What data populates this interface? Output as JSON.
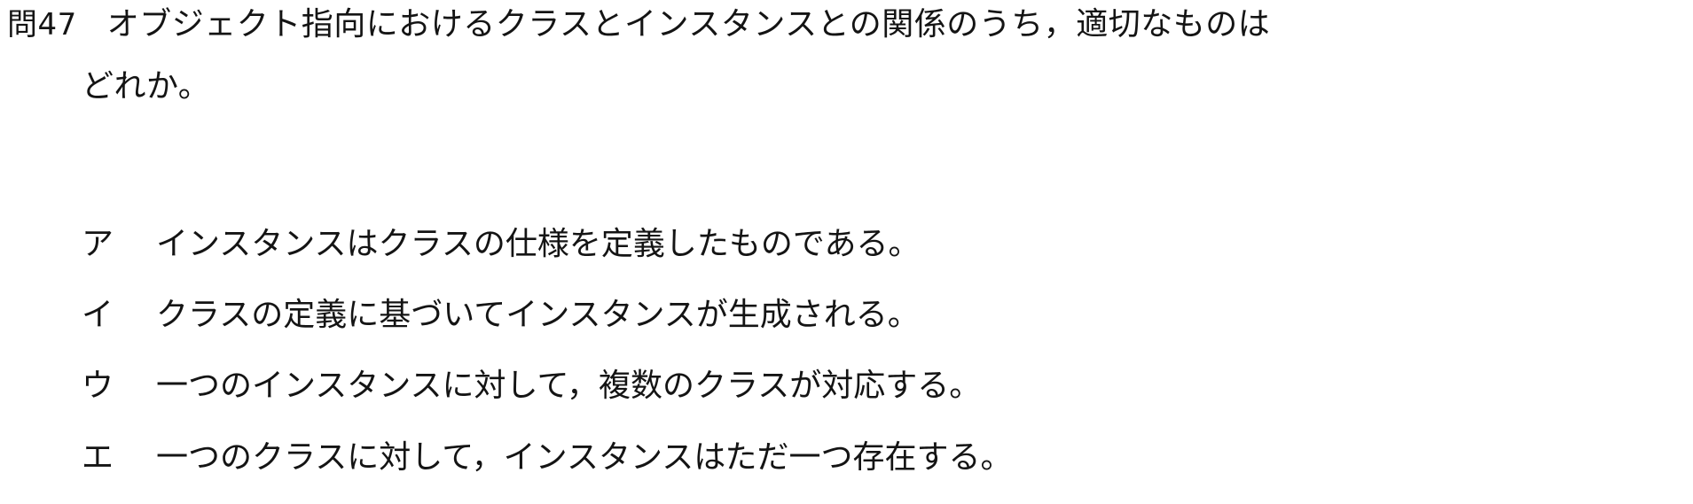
{
  "question": {
    "number": "問47",
    "line1": "オブジェクト指向におけるクラスとインスタンスとの関係のうち，適切なものは",
    "line2": "どれか。"
  },
  "choices": [
    {
      "label": "ア",
      "text": "インスタンスはクラスの仕様を定義したものである。"
    },
    {
      "label": "イ",
      "text": "クラスの定義に基づいてインスタンスが生成される。"
    },
    {
      "label": "ウ",
      "text": "一つのインスタンスに対して，複数のクラスが対応する。"
    },
    {
      "label": "エ",
      "text": "一つのクラスに対して，インスタンスはただ一つ存在する。"
    }
  ]
}
